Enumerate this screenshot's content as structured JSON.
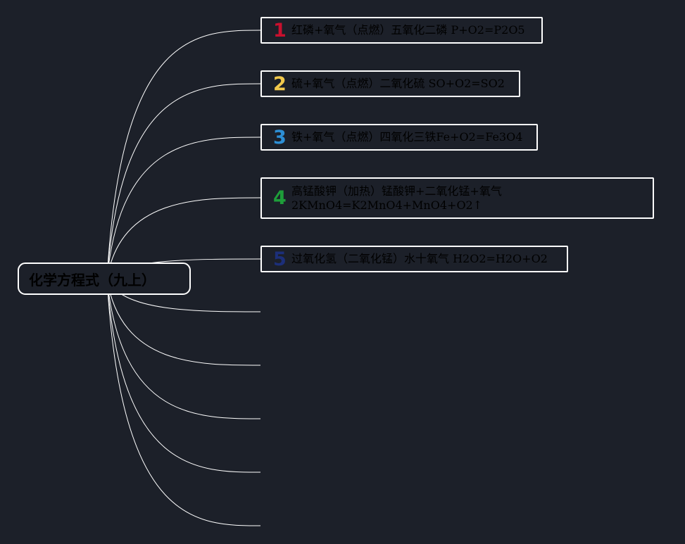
{
  "root": {
    "label": "化学方程式（九上）"
  },
  "colors": {
    "background": "#1c2029",
    "line": "#ffffff",
    "text": "#000000"
  },
  "nodes": [
    {
      "badge": "1",
      "badge_color": "#c8102e",
      "lines": [
        "红磷+氧气（点燃）五氧化二磷 P+O2=P2O5"
      ]
    },
    {
      "badge": "2",
      "badge_color": "#f2c94c",
      "lines": [
        "硫+氧气（点燃）二氧化硫 SO+O2=SO2"
      ]
    },
    {
      "badge": "3",
      "badge_color": "#2d8fd5",
      "lines": [
        "铁+氧气（点燃）四氧化三铁Fe+O2=Fe3O4"
      ]
    },
    {
      "badge": "4",
      "badge_color": "#1e9e3a",
      "lines": [
        "高锰酸钾（加热）锰酸钾+二氧化锰+氧气",
        "2KMnO4=K2MnO4+MnO4+O2↑"
      ]
    },
    {
      "badge": "5",
      "badge_color": "#1c2f7a",
      "lines": [
        "过氧化氢（二氧化锰）水十氧气 H2O2=H2O+O2"
      ]
    }
  ]
}
